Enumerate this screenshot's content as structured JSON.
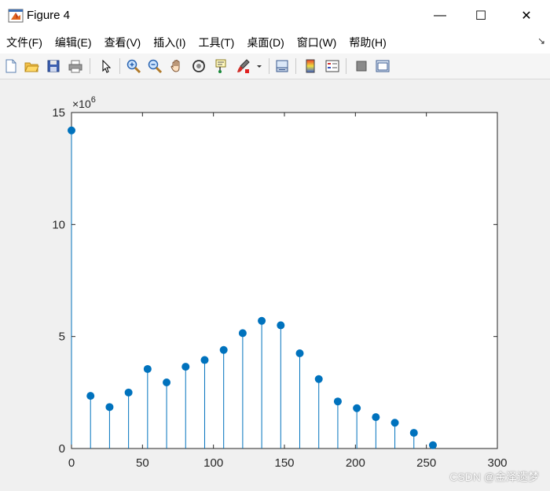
{
  "window": {
    "title": "Figure 4",
    "minimize_glyph": "—",
    "maximize_glyph": "☐",
    "close_glyph": "✕"
  },
  "menu": [
    {
      "id": "file",
      "label": "文件(F)"
    },
    {
      "id": "edit",
      "label": "编辑(E)"
    },
    {
      "id": "view",
      "label": "查看(V)"
    },
    {
      "id": "insert",
      "label": "插入(I)"
    },
    {
      "id": "tools",
      "label": "工具(T)"
    },
    {
      "id": "desktop",
      "label": "桌面(D)"
    },
    {
      "id": "window",
      "label": "窗口(W)"
    },
    {
      "id": "help",
      "label": "帮助(H)"
    }
  ],
  "toolbar": {
    "icons": [
      "new-figure-icon",
      "open-file-icon",
      "save-icon",
      "print-icon",
      "select-arrow-icon",
      "zoom-in-icon",
      "zoom-out-icon",
      "pan-hand-icon",
      "rotate-3d-icon",
      "data-cursor-icon",
      "brush-icon",
      "link-plot-icon",
      "colorbar-icon",
      "legend-icon",
      "hide-plot-tools-icon",
      "show-plot-tools-icon"
    ]
  },
  "chart_data": {
    "type": "stem",
    "x": [
      0,
      13.4,
      26.8,
      40.2,
      53.6,
      67,
      80.4,
      93.8,
      107.2,
      120.6,
      134,
      147.4,
      160.8,
      174.2,
      187.6,
      201,
      214.4,
      227.8,
      241.2,
      254.6
    ],
    "y": [
      14.2,
      2.35,
      1.85,
      2.5,
      3.55,
      2.95,
      3.65,
      3.95,
      4.4,
      5.15,
      5.7,
      5.5,
      4.25,
      3.1,
      2.1,
      1.8,
      1.4,
      1.15,
      0.7,
      0.15
    ],
    "xlim": [
      0,
      300
    ],
    "ylim": [
      0,
      15
    ],
    "xticks": [
      0,
      50,
      100,
      150,
      200,
      250,
      300
    ],
    "yticks": [
      0,
      5,
      10,
      15
    ],
    "y_multiplier_label": "×10",
    "y_multiplier_exponent": "6",
    "grid": false,
    "series_color": "#0072bd"
  },
  "watermark": "CSDN @金泽遗梦"
}
